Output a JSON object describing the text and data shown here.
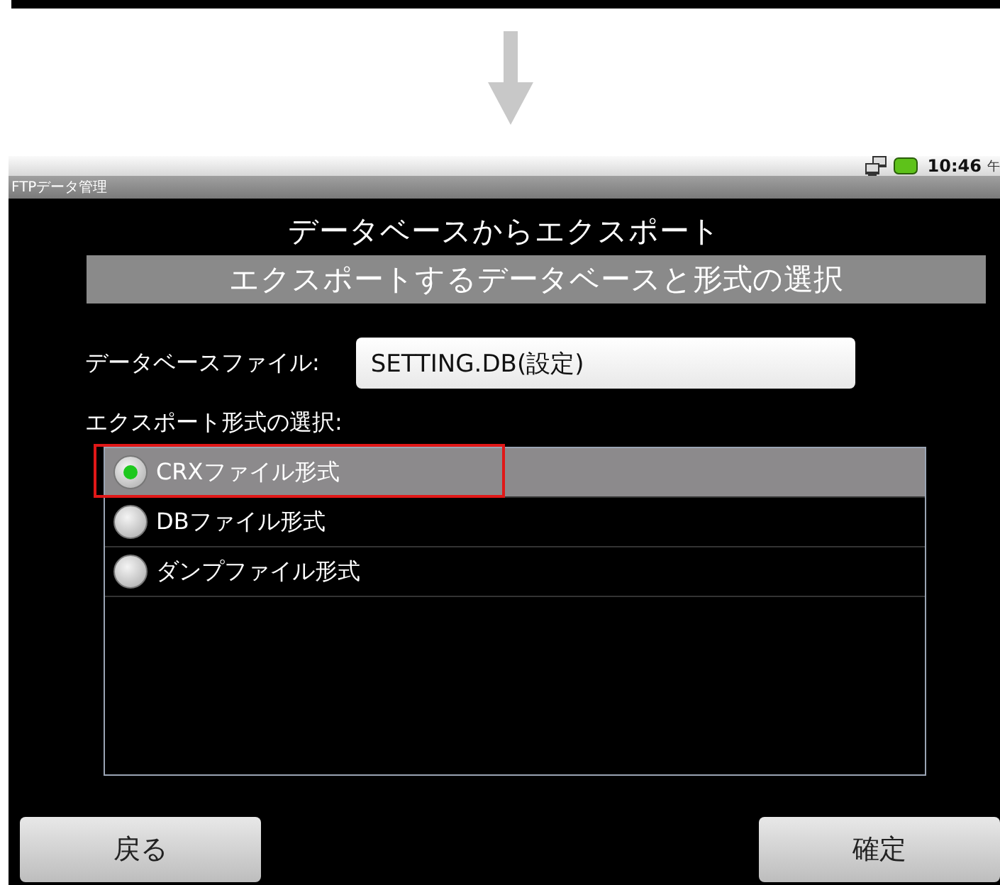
{
  "status_bar": {
    "time": "10:46",
    "meridiem": "午"
  },
  "app_title": "FTPデータ管理",
  "heading": "データベースからエクスポート",
  "subheading": "エクスポートするデータベースと形式の選択",
  "database_file": {
    "label": "データベースファイル:",
    "value": "SETTING.DB(設定)"
  },
  "format": {
    "label": "エクスポート形式の選択:",
    "options": [
      {
        "label": "CRXファイル形式",
        "selected": true,
        "annotated": true
      },
      {
        "label": "DBファイル形式",
        "selected": false,
        "annotated": false
      },
      {
        "label": "ダンプファイル形式",
        "selected": false,
        "annotated": false
      }
    ]
  },
  "buttons": [
    {
      "label": "戻る",
      "kind": "back"
    },
    {
      "label": "確定",
      "kind": "confirm"
    }
  ]
}
